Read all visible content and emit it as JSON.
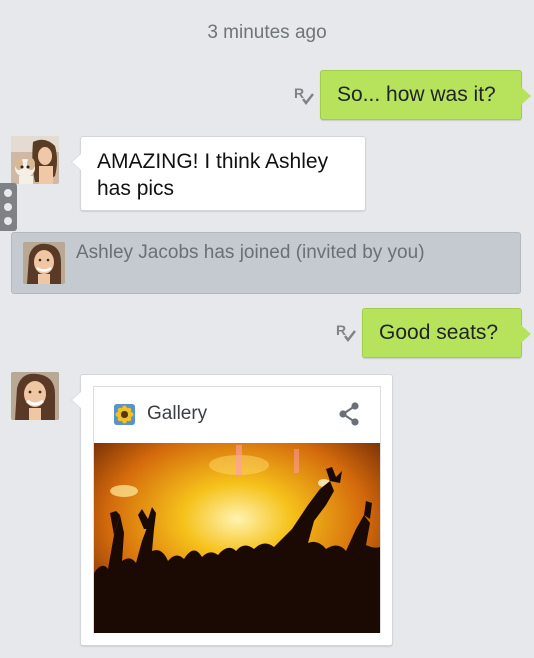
{
  "timestamp": "3 minutes ago",
  "messages": [
    {
      "direction": "outgoing",
      "text": "So... how was it?",
      "status_icon": "read-receipt-icon"
    },
    {
      "direction": "incoming",
      "text": "AMAZING! I think Ashley has pics",
      "avatar": "avatar-woman-with-puppy"
    },
    {
      "direction": "outgoing",
      "text": "Good seats?",
      "status_icon": "read-receipt-icon"
    }
  ],
  "system_event": {
    "text": "Ashley Jacobs has joined (invited by you)",
    "avatar": "avatar-ashley-jacobs"
  },
  "shared_card": {
    "app_label": "Gallery",
    "app_icon": "gallery-sunflower-icon",
    "action_icon": "share-icon",
    "image": "concert-crowd-photo"
  },
  "colors": {
    "background": "#e6e8ec",
    "outgoing_bubble": "#b6e35b",
    "incoming_bubble": "#ffffff",
    "system_row": "#c5c9d0",
    "timestamp": "#6f7478"
  }
}
